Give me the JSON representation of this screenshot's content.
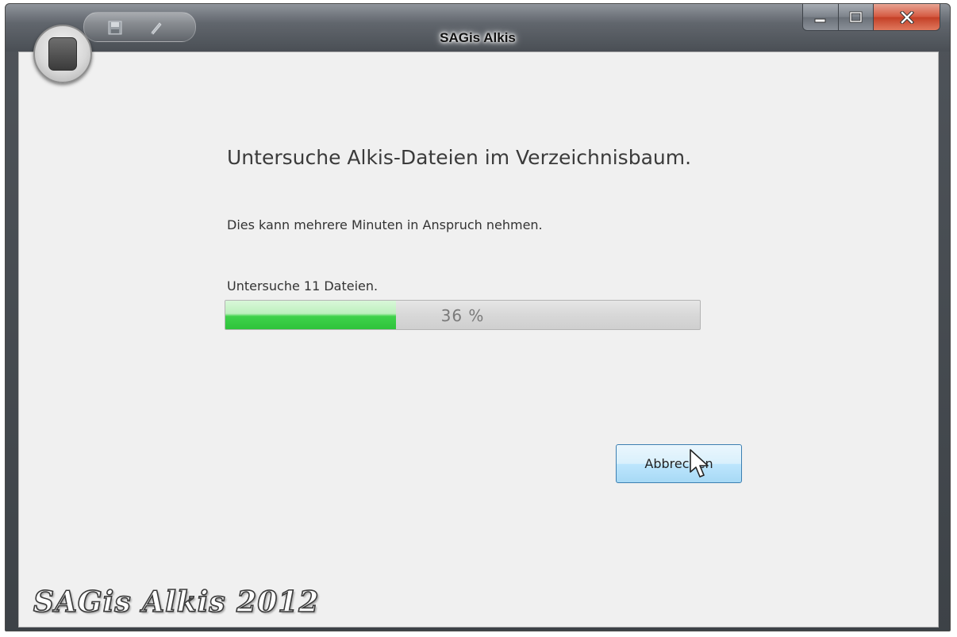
{
  "window": {
    "title": "SAGis Alkis"
  },
  "main": {
    "heading": "Untersuche Alkis-Dateien im Verzeichnisbaum.",
    "info": "Dies kann mehrere Minuten in Anspruch nehmen.",
    "status": "Untersuche 11 Dateien.",
    "progress": {
      "value_percent": 36,
      "label": "36  %"
    },
    "cancel_label": "Abbrechen"
  },
  "branding": {
    "text": "SAGis Alkis 2012"
  },
  "icons": {
    "app": "app-orb-icon",
    "qat_save": "save-icon",
    "qat_edit": "edit-icon",
    "minimize": "minimize-icon",
    "maximize": "maximize-icon",
    "close": "close-icon",
    "cursor": "mouse-cursor-icon"
  },
  "colors": {
    "progress_green": "#2fc33b",
    "button_blue": "#bee6fd",
    "close_red": "#c33f26",
    "client_bg": "#f0f0f0"
  }
}
